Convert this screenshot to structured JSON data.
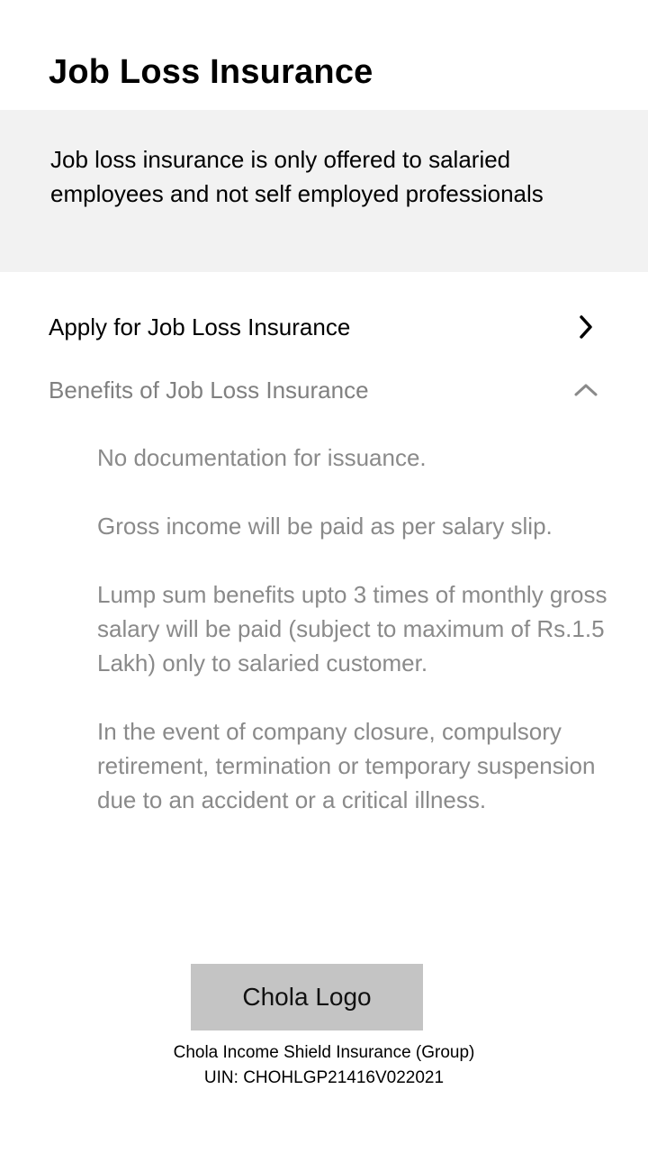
{
  "header": {
    "title": "Job Loss Insurance"
  },
  "notice": {
    "text": "Job loss insurance is only offered to salaried employees and not self employed professionals"
  },
  "apply": {
    "label": "Apply for Job Loss Insurance",
    "icon": "chevron-right-icon"
  },
  "benefits": {
    "label": "Benefits of Job Loss Insurance",
    "icon": "chevron-up-icon",
    "expanded": true,
    "items": [
      "No documentation for issuance.",
      "Gross income will be paid as per salary slip.",
      "Lump sum benefits upto 3 times of monthly gross salary will be paid (subject to maximum of Rs.1.5 Lakh) only to salaried customer.",
      "In the event of company closure, compulsory retirement, termination or temporary suspension due to an accident or a critical illness."
    ]
  },
  "logo": {
    "label": "Chola Logo",
    "background": "#c4c4c4"
  },
  "footer": {
    "product_name": "Chola Income Shield Insurance (Group)",
    "uin": "UIN: CHOHLGP21416V022021"
  },
  "colors": {
    "notice_background": "#f2f2f2",
    "muted_text": "#8a8a8a"
  }
}
